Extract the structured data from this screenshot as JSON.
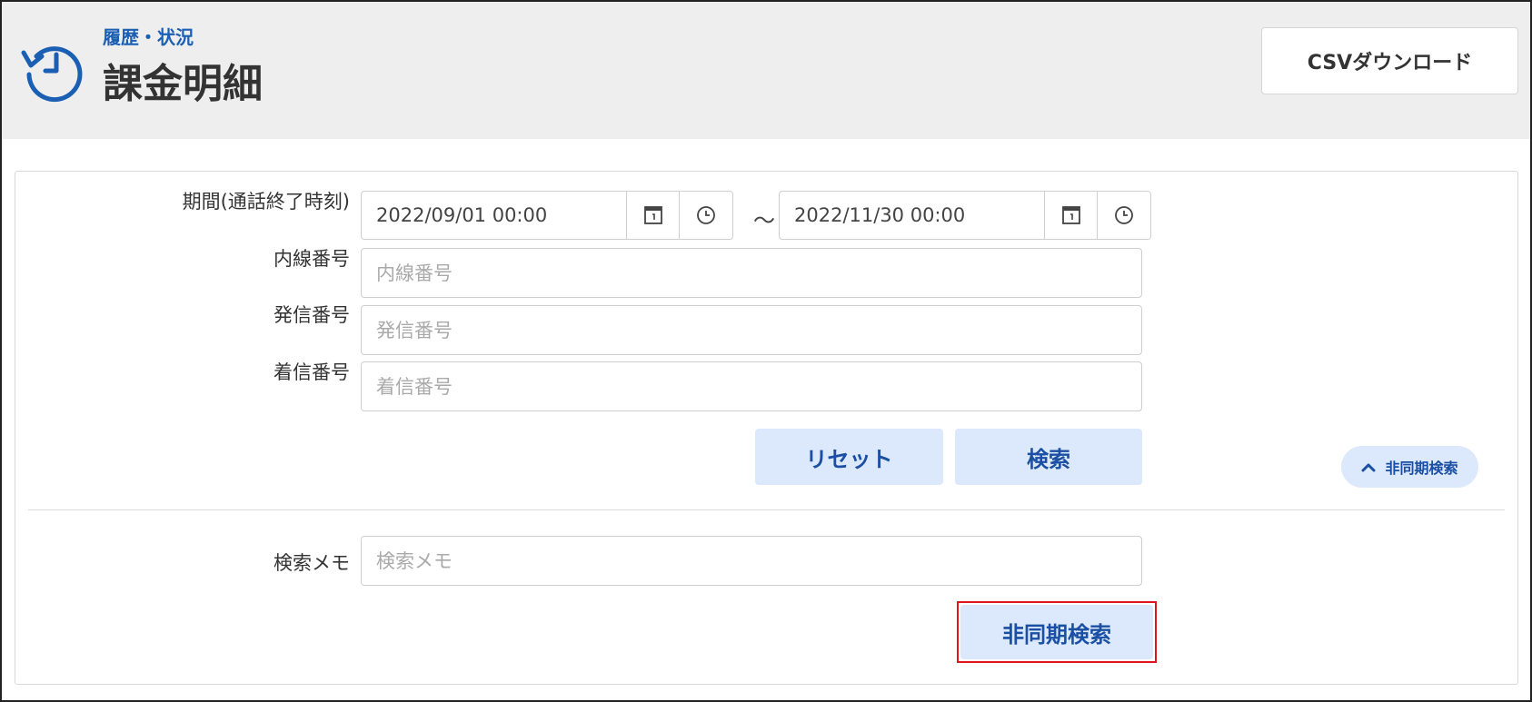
{
  "header": {
    "breadcrumb": "履歴・状況",
    "title": "課金明細",
    "csv_download_label": "CSVダウンロード",
    "icon": "history-icon",
    "accent_color": "#1a5fb4"
  },
  "filters": {
    "period": {
      "label": "期間(通話終了時刻)",
      "start": "2022/09/01 00:00",
      "end": "2022/11/30 00:00",
      "separator": "～"
    },
    "extension": {
      "label": "内線番号",
      "placeholder": "内線番号",
      "value": ""
    },
    "caller": {
      "label": "発信番号",
      "placeholder": "発信番号",
      "value": ""
    },
    "callee": {
      "label": "着信番号",
      "placeholder": "着信番号",
      "value": ""
    },
    "reset_label": "リセット",
    "search_label": "検索",
    "async_toggle_label": "非同期検索"
  },
  "async_search": {
    "memo_label": "検索メモ",
    "memo_placeholder": "検索メモ",
    "memo_value": "",
    "button_label": "非同期検索"
  }
}
